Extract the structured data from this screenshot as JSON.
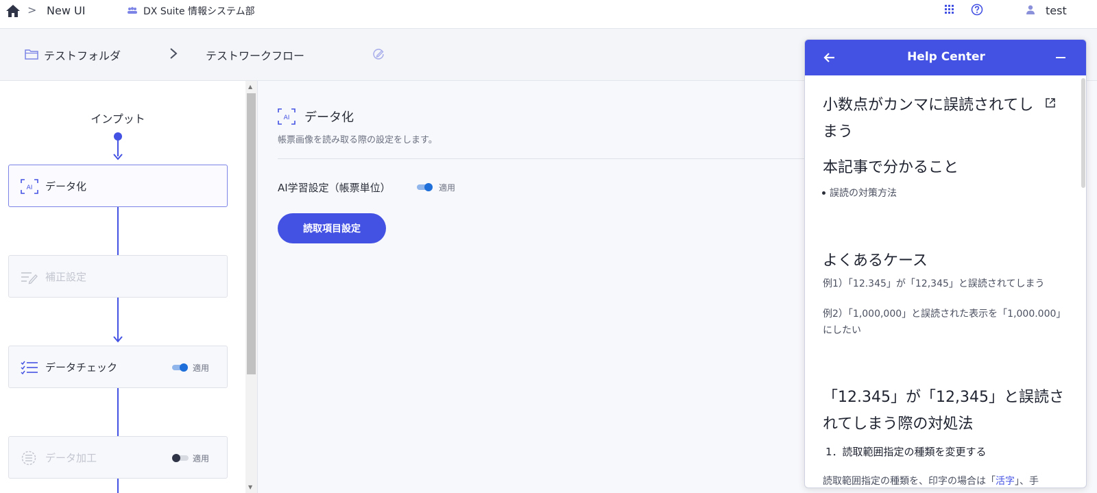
{
  "topbar": {
    "app_name": "New UI",
    "breadcrumb_separator": ">",
    "org_name": "DX Suite 情報システム部",
    "user_name": "test",
    "icons": [
      "home-icon",
      "org-icon",
      "apps-grid-icon",
      "help-icon",
      "user-icon"
    ]
  },
  "path": {
    "folder": "テストフォルダ",
    "workflow": "テストワークフロー"
  },
  "flow": {
    "input_label": "インプット",
    "steps": [
      {
        "label": "データ化",
        "state": "active",
        "icon": "ai-icon"
      },
      {
        "label": "補正設定",
        "state": "disabled",
        "icon": "correction-icon"
      },
      {
        "label": "データチェック",
        "state": "enabled",
        "icon": "checklist-icon",
        "toggle_label": "適用",
        "toggle_on": true
      },
      {
        "label": "データ加工",
        "state": "disabled",
        "icon": "data-process-icon",
        "toggle_label": "適用",
        "toggle_on": false
      }
    ]
  },
  "main": {
    "title": "データ化",
    "description": "帳票画像を読み取る際の設定をします。",
    "ai_setting_label": "AI学習設定（帳票単位）",
    "ai_toggle_label": "適用",
    "ai_toggle_on": true,
    "primary_button": "読取項目設定"
  },
  "help": {
    "title": "Help Center",
    "article_title": "小数点がカンマに誤読されてしまう",
    "section1_title": "本記事で分かること",
    "section1_bullet": "誤読の対策方法",
    "section2_title": "よくあるケース",
    "example1": "例1）「12.345」が「12,345」と誤読されてしまう",
    "example2": "例2）「1,000,000」と誤読された表示を「1,000.000」にしたい",
    "section3_title": "「12.345」が「12,345」と誤読されてしまう際の対処法",
    "step1_title": "1．読取範囲指定の種類を変更する",
    "step1_text_before": "読取範囲指定の種類を、印字の場合は「",
    "step1_link": "活字",
    "step1_text_after": "」、手"
  },
  "colors": {
    "accent": "#4452e3",
    "toggle_on": "#1e6fd9",
    "toggle_off": "#2f3447"
  }
}
